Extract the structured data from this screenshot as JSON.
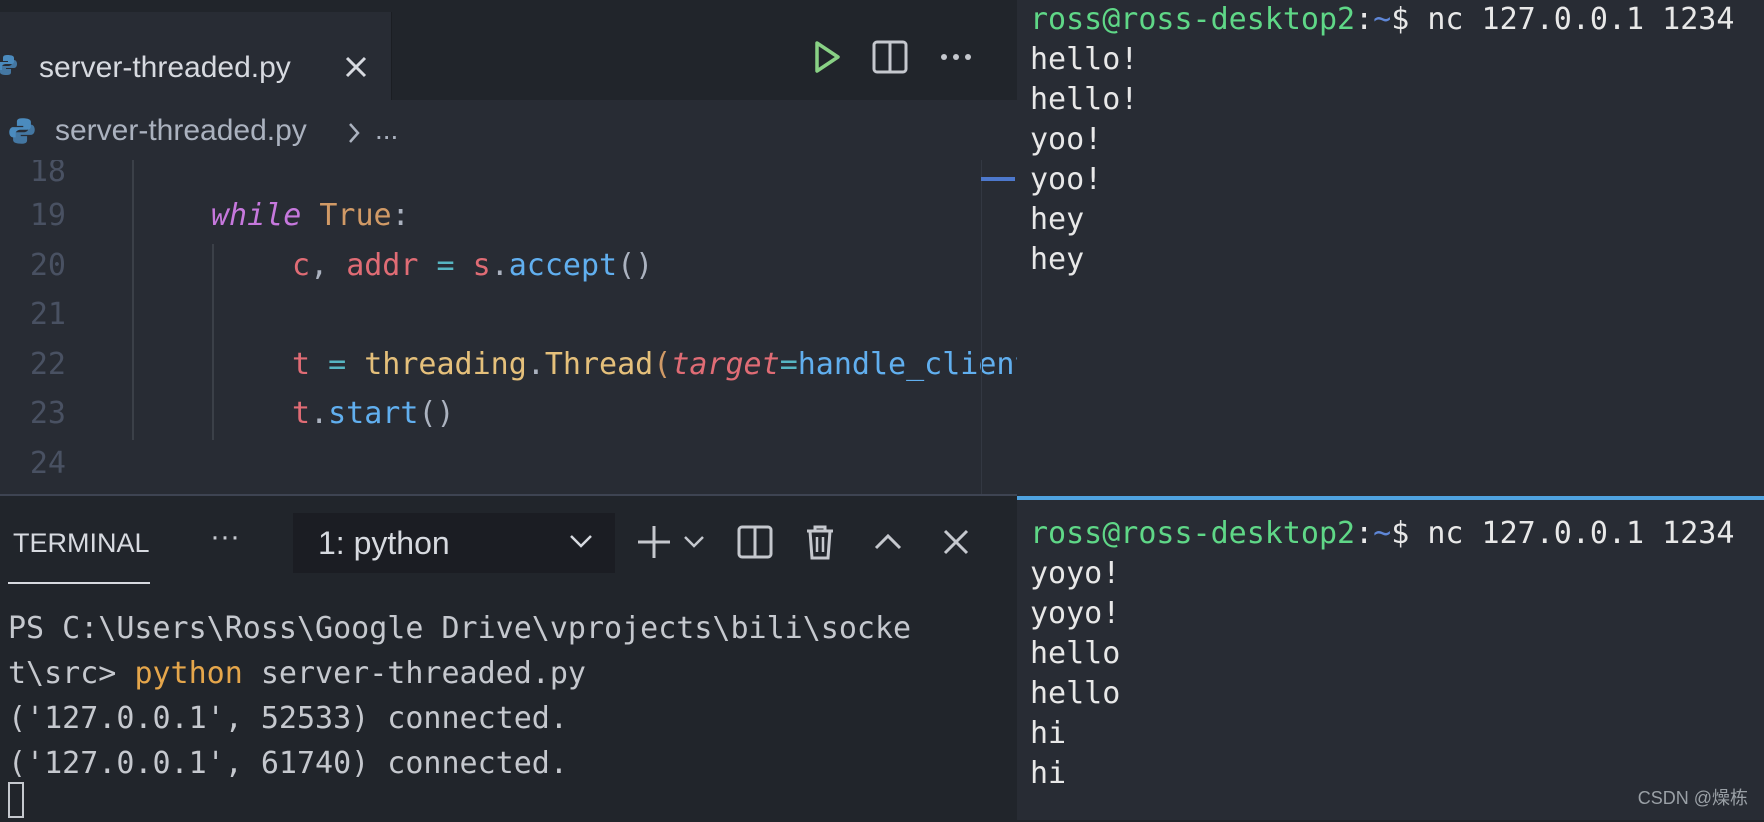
{
  "editor": {
    "tab": {
      "filename": "server-threaded.py"
    },
    "breadcrumb": {
      "file": "server-threaded.py",
      "more": "..."
    },
    "lines": [
      {
        "num": "18"
      },
      {
        "num": "19"
      },
      {
        "num": "20"
      },
      {
        "num": "21"
      },
      {
        "num": "22"
      },
      {
        "num": "23"
      },
      {
        "num": "24"
      }
    ],
    "code": {
      "l19_kw": "while",
      "l19_const": "True",
      "l19_colon": ":",
      "l20_c": "c",
      "l20_comma": ", ",
      "l20_addr": "addr",
      "l20_eq": " = ",
      "l20_s": "s",
      "l20_dot": ".",
      "l20_fn": "accept",
      "l20_paren": "()",
      "l22_t": "t",
      "l22_eq": " = ",
      "l22_mod": "threading",
      "l22_dot": ".",
      "l22_cls": "Thread",
      "l22_open": "(",
      "l22_param": "target",
      "l22_eq2": "=",
      "l22_arg": "handle_client",
      "l23_t": "t",
      "l23_dot": ".",
      "l23_fn": "start",
      "l23_paren": "()"
    }
  },
  "panel": {
    "tab_label": "TERMINAL",
    "more_label": "···",
    "select_value": "1: python",
    "output": {
      "line1": "PS C:\\Users\\Ross\\Google Drive\\vprojects\\bili\\socke",
      "line2_prefix": "t\\src> ",
      "line2_cmd": "python",
      "line2_rest": " server-threaded.py",
      "line3": "('127.0.0.1', 52533) connected.",
      "line4": "('127.0.0.1', 61740) connected."
    }
  },
  "right_terminal": {
    "top": {
      "prompt_user": "ross@ross-desktop2",
      "prompt_sep": ":",
      "prompt_path": "~",
      "prompt_cmd": "$ nc 127.0.0.1 1234",
      "lines": [
        "hello!",
        "hello!",
        "yoo!",
        "yoo!",
        "hey",
        "hey"
      ]
    },
    "bottom": {
      "prompt_user": "ross@ross-desktop2",
      "prompt_sep": ":",
      "prompt_path": "~",
      "prompt_cmd": "$ nc 127.0.0.1 1234",
      "lines": [
        "yoyo!",
        "yoyo!",
        "hello",
        "hello",
        "hi",
        "hi"
      ]
    }
  },
  "watermark": "CSDN @燥栋",
  "colors": {
    "accent": "#4fa3e0",
    "prompt_user": "#5fd787",
    "prompt_path": "#5f87d7"
  }
}
